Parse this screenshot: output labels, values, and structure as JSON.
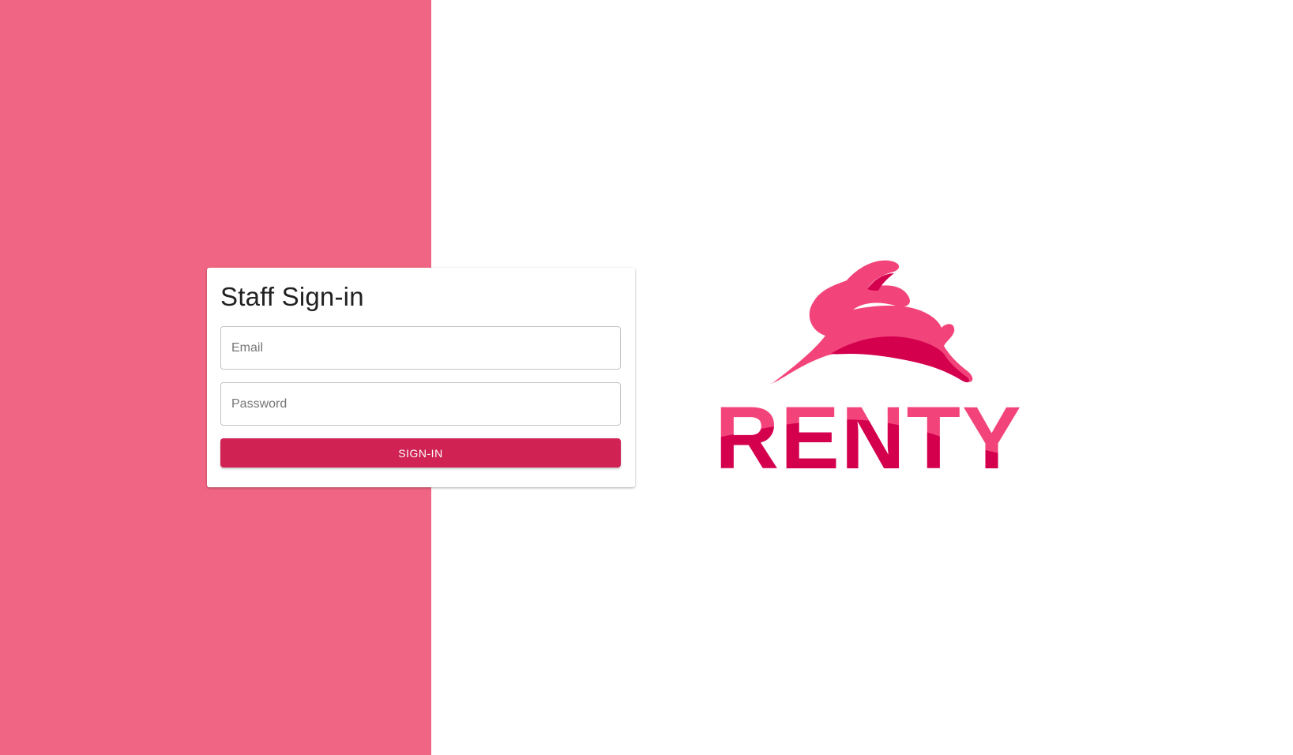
{
  "brand": {
    "name": "RENTY",
    "colors": {
      "panel": "#f06583",
      "primary": "#d02354",
      "logo_light": "#f2447a",
      "logo_dark": "#d4004e"
    }
  },
  "signin": {
    "title": "Staff Sign-in",
    "email_placeholder": "Email",
    "password_placeholder": "Password",
    "submit_label": "SIGN-IN"
  }
}
